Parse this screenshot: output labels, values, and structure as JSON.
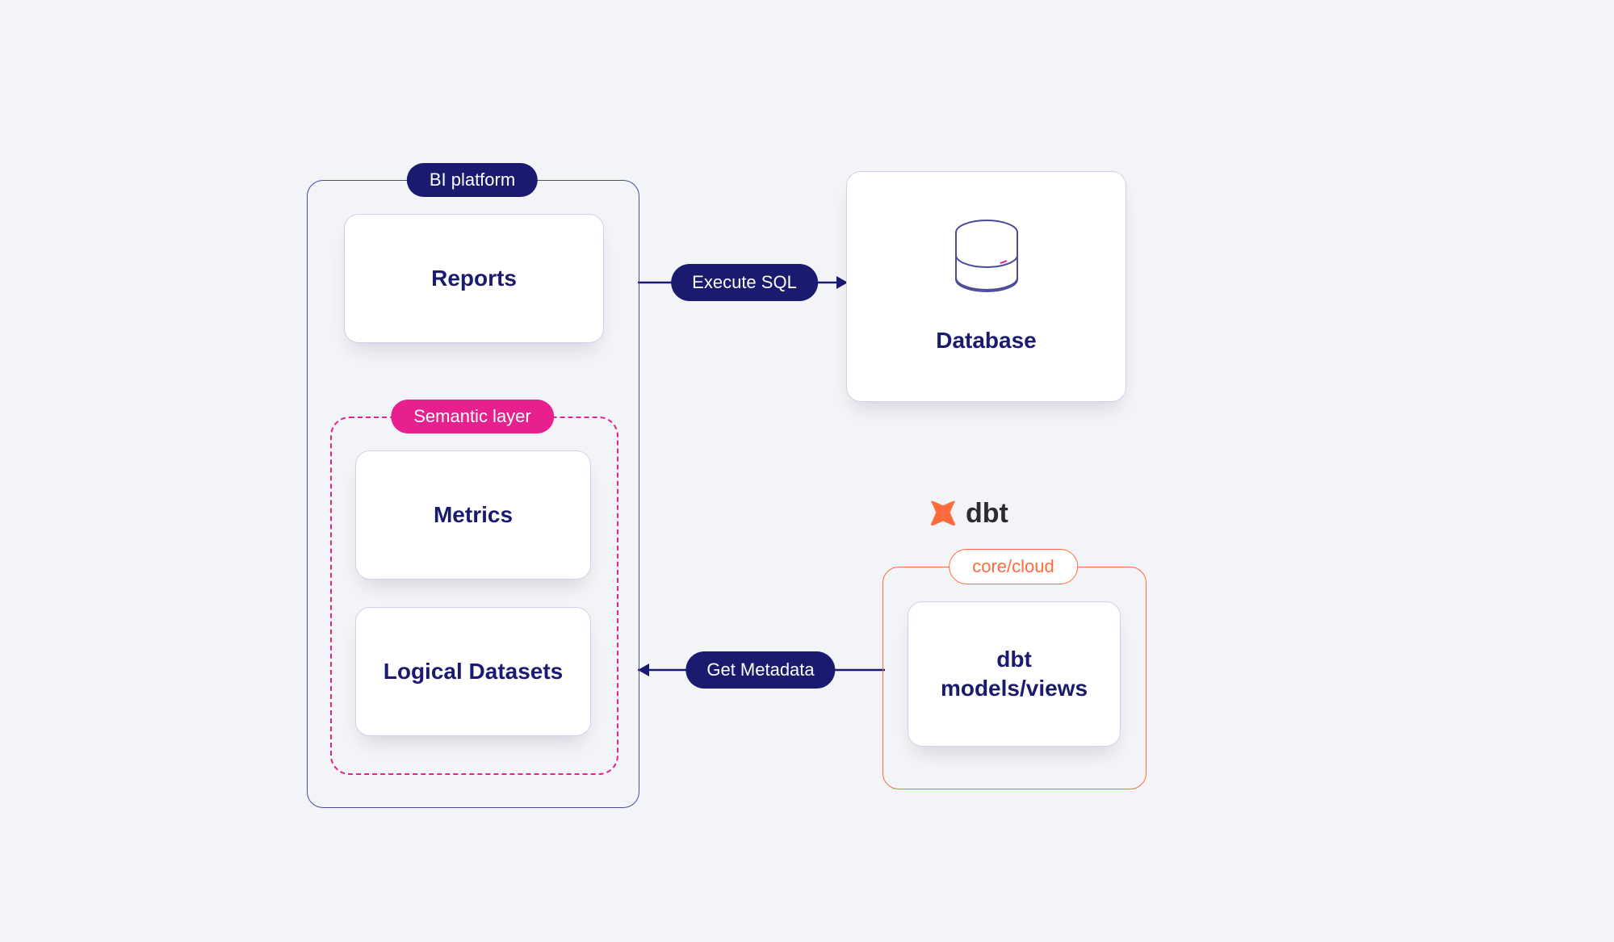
{
  "containers": {
    "bi": "BI platform",
    "semantic": "Semantic layer",
    "dbt_box": "core/cloud"
  },
  "cards": {
    "reports": "Reports",
    "metrics": "Metrics",
    "logical": "Logical Datasets",
    "database": "Database",
    "dbt_models": "dbt\nmodels/views"
  },
  "edges": {
    "execute_sql": "Execute SQL",
    "get_metadata": "Get Metadata"
  },
  "dbt_logo_text": "dbt"
}
